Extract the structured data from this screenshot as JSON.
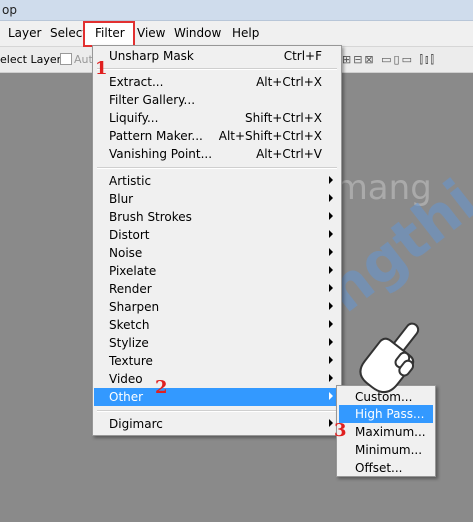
{
  "titlebar": {
    "text": "op"
  },
  "menubar": {
    "items": [
      "Layer",
      "Select",
      "Filter",
      "View",
      "Window",
      "Help"
    ]
  },
  "options": {
    "auto_select": "elect Layer",
    "auto": "Aut"
  },
  "filter_menu": {
    "top": [
      {
        "label": "Unsharp Mask",
        "shortcut": "Ctrl+F"
      }
    ],
    "group2": [
      {
        "label": "Extract...",
        "shortcut": "Alt+Ctrl+X"
      },
      {
        "label": "Filter Gallery...",
        "shortcut": ""
      },
      {
        "label": "Liquify...",
        "shortcut": "Shift+Ctrl+X"
      },
      {
        "label": "Pattern Maker...",
        "shortcut": "Alt+Shift+Ctrl+X"
      },
      {
        "label": "Vanishing Point...",
        "shortcut": "Alt+Ctrl+V"
      }
    ],
    "group3": [
      "Artistic",
      "Blur",
      "Brush Strokes",
      "Distort",
      "Noise",
      "Pixelate",
      "Render",
      "Sharpen",
      "Sketch",
      "Stylize",
      "Texture",
      "Video",
      "Other"
    ],
    "bottom": "Digimarc"
  },
  "other_submenu": [
    "Custom...",
    "High Pass...",
    "Maximum...",
    "Minimum...",
    "Offset..."
  ],
  "steps": {
    "one": "1",
    "two": "2",
    "three": "3"
  },
  "watermarks": {
    "main": "uantrimang",
    "diag": "Truongthi.top"
  },
  "colors": {
    "highlight": "#3399ff",
    "annotation": "#e02020"
  }
}
